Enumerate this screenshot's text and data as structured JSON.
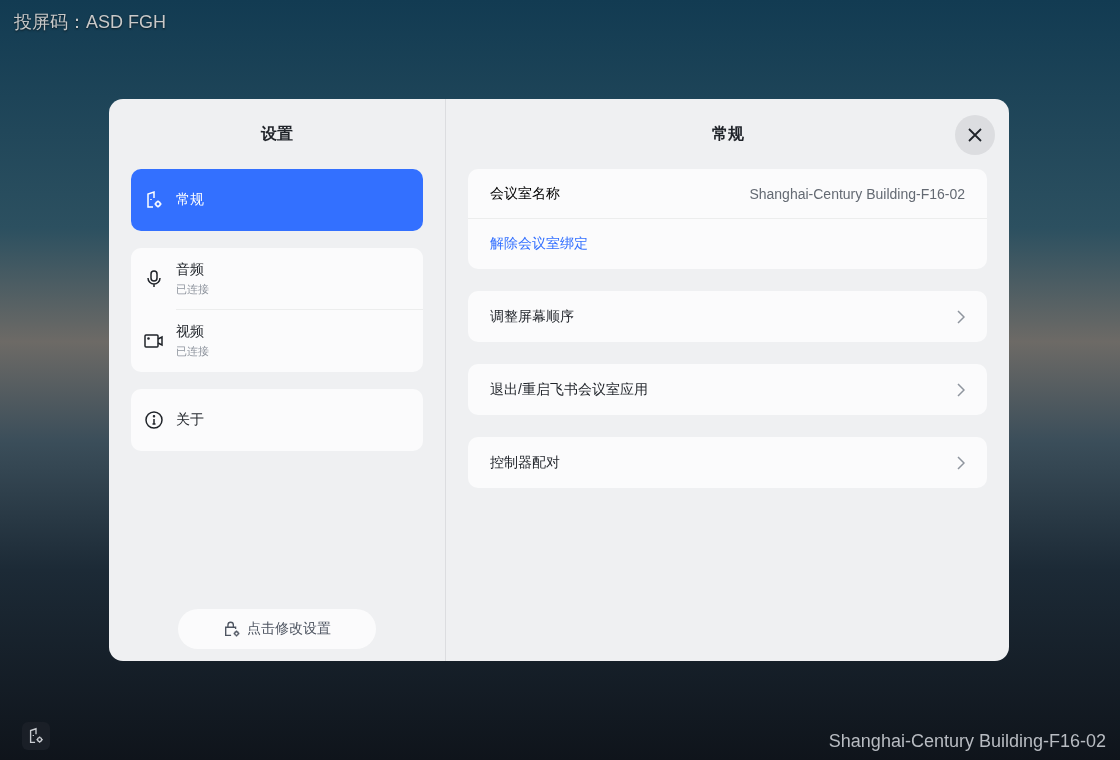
{
  "screen_code": "投屏码：ASD FGH",
  "settings": {
    "title": "设置",
    "nav_groups": [
      [
        {
          "kind": "general",
          "label": "常规",
          "selected": true
        }
      ],
      [
        {
          "kind": "microphone",
          "label": "音频",
          "status": "已连接",
          "selected": false
        },
        {
          "kind": "camera",
          "label": "视频",
          "status": "已连接",
          "selected": false
        }
      ],
      [
        {
          "kind": "info",
          "label": "关于",
          "selected": false
        }
      ]
    ],
    "unlock_button": "点击修改设置"
  },
  "panel": {
    "title": "常规",
    "cards": [
      {
        "kind": "info",
        "label": "会议室名称",
        "value": "Shanghai-Century Building-F16-02",
        "link": "解除会议室绑定"
      },
      {
        "kind": "nav",
        "label": "调整屏幕顺序"
      },
      {
        "kind": "nav",
        "label": "退出/重启飞书会议室应用"
      },
      {
        "kind": "nav",
        "label": "控制器配对"
      }
    ]
  },
  "room_name": "Shanghai-Century Building-F16-02"
}
